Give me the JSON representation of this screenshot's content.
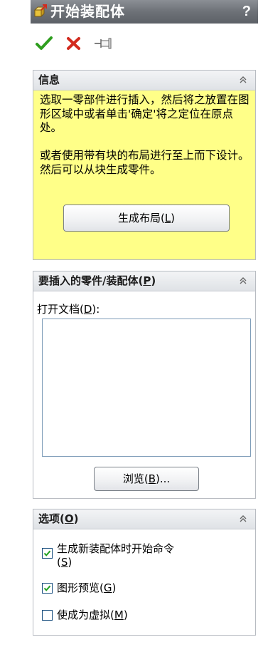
{
  "titlebar": {
    "title": "开始装配体",
    "help": "?",
    "icon": "assembly-icon"
  },
  "toolbar": {
    "ok_icon": "checkmark-icon",
    "cancel_icon": "close-icon",
    "pin_icon": "pushpin-icon"
  },
  "colors": {
    "ok": "#2f9e1f",
    "cancel": "#d22a1e",
    "info_bg": "#ffff88",
    "title_bg": "#6d7177"
  },
  "info": {
    "title": "信息",
    "text_1": "选取一零部件进行插入，然后将之放置在图形区域中或者单击'确定'将之定位在原点处。",
    "text_2": "或者使用带有块的布局进行至上而下设计。然后可以从块生成零件。",
    "layout_button_prefix": "生成布局(",
    "layout_button_key": "L",
    "layout_button_suffix": ")"
  },
  "insert": {
    "title_prefix": "要插入的零件/装配体(",
    "title_key": "P",
    "title_suffix": ")",
    "open_docs_prefix": "打开文档(",
    "open_docs_key": "D",
    "open_docs_suffix": "):",
    "browse_prefix": "浏览(",
    "browse_key": "B",
    "browse_suffix": ")..."
  },
  "options": {
    "title_prefix": "选项(",
    "title_key": "O",
    "title_suffix": ")",
    "items": [
      {
        "line1": "生成新装配体时开始命令",
        "prefix": "(",
        "key": "S",
        "suffix": ")",
        "checked": true
      },
      {
        "line1": "图形预览(",
        "key": "G",
        "suffix": ")",
        "checked": true
      },
      {
        "line1": "使成为虚拟(",
        "key": "M",
        "suffix": ")",
        "checked": false
      }
    ]
  }
}
